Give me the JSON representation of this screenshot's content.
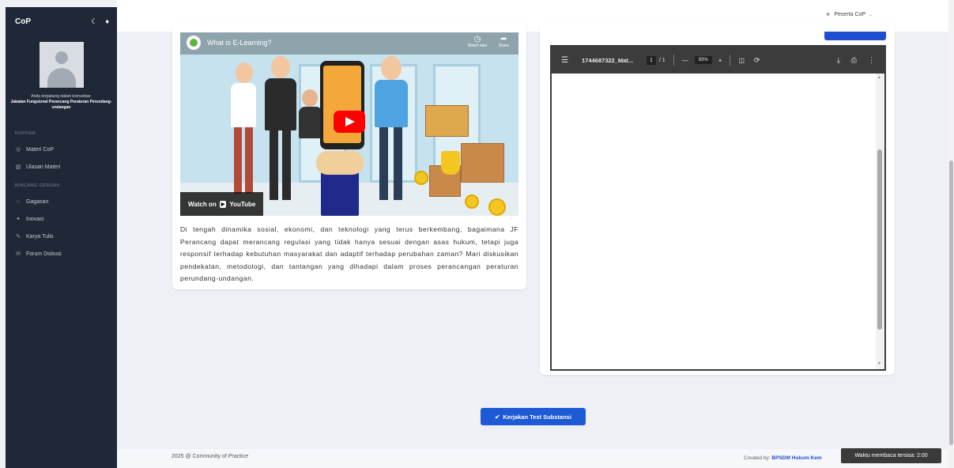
{
  "sidebar": {
    "brand": "CoP",
    "theme_icon": "moon-icon",
    "notif_icon": "bell-icon",
    "community_prefix": "Anda tergabung dalam komunitas:",
    "community_name": "Jabatan Fungsional Perancang Peraturan Perundang-undangan",
    "sections": [
      {
        "title": "KOPDAR",
        "items": [
          {
            "icon": "book-icon",
            "label": "Materi CoP"
          },
          {
            "icon": "chart-icon",
            "label": "Ulasan Materi"
          }
        ]
      },
      {
        "title": "BINCANG CERDAS",
        "items": [
          {
            "icon": "bulb-icon",
            "label": "Gagasan"
          },
          {
            "icon": "star-icon",
            "label": "Inovasi"
          },
          {
            "icon": "pen-icon",
            "label": "Karya Tulis"
          },
          {
            "icon": "chat-icon",
            "label": "Forum Diskusi"
          }
        ]
      }
    ]
  },
  "topbar": {
    "user_label": "Peserta CoP"
  },
  "video": {
    "title": "What is E-Learning?",
    "watch_later": "Watch later",
    "share": "Share",
    "watch_on": "Watch on",
    "youtube": "YouTube"
  },
  "caption": "Di tengah dinamika sosial, ekonomi, dan teknologi yang terus berkembang, bagaimana JF Perancang dapat merancang regulasi yang tidak hanya sesuai dengan asas hukum, tetapi juga responsif terhadap kebutuhan masyarakat dan adaptif terhadap perubahan zaman? Mari diskusikan pendekatan, metodologi, dan tantangan yang dihadapi dalam proses perancangan peraturan perundang-undangan.",
  "pdf": {
    "filename": "1744687322_Mat...",
    "page_current": "1",
    "page_total": "/ 1",
    "zoom": "83%"
  },
  "actions": {
    "test_button": "Kerjakan Test Substansi"
  },
  "footer": {
    "left": "2025 @ Community of Practice",
    "right_prefix": "Created by:",
    "right_link": "BPSDM Hukum Kem"
  },
  "timer": "Waktu membaca tersisa: 2:00"
}
